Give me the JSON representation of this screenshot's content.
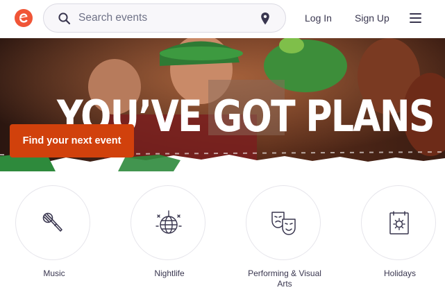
{
  "header": {
    "logo": {
      "icon": "eventbrite-logo-icon",
      "color": "#f05537"
    },
    "search": {
      "placeholder": "Search events",
      "icon": "search-icon",
      "location_icon": "location-pin-icon"
    },
    "login_label": "Log In",
    "signup_label": "Sign Up",
    "menu_icon": "hamburger-menu-icon"
  },
  "hero": {
    "title": "YOU’VE GOT PLANS",
    "cta_label": "Find your next event",
    "cta_color": "#d1410c"
  },
  "categories": [
    {
      "label": "Music",
      "icon": "microphone-icon"
    },
    {
      "label": "Nightlife",
      "icon": "disco-ball-icon"
    },
    {
      "label": "Performing & Visual Arts",
      "icon": "theater-masks-icon"
    },
    {
      "label": "Holidays",
      "icon": "calendar-sun-icon"
    }
  ]
}
